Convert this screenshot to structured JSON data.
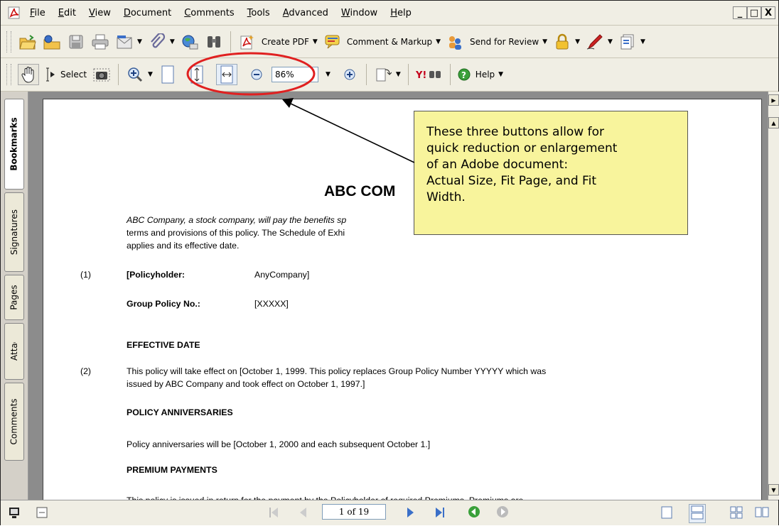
{
  "menu": [
    "File",
    "Edit",
    "View",
    "Document",
    "Comments",
    "Tools",
    "Advanced",
    "Window",
    "Help"
  ],
  "window_controls": [
    "_",
    "□",
    "X"
  ],
  "toolbar1": {
    "create_pdf": "Create PDF",
    "comment_markup": "Comment & Markup",
    "send_for_review": "Send for Review"
  },
  "toolbar2": {
    "select": "Select",
    "zoom_value": "86%",
    "help": "Help"
  },
  "nav_tabs": [
    "Bookmarks",
    "Signatures",
    "Pages",
    "Attachments",
    "Comments"
  ],
  "document": {
    "title": "ABC COM",
    "intro_line1": "ABC Company, a stock company, will pay the benefits sp",
    "intro_line2": "terms and provisions of this policy.  The Schedule of Exhi",
    "intro_line3": "applies and its effective date.",
    "item1_num": "(1)",
    "policyholder_label": "[Policyholder:",
    "policyholder_value": "AnyCompany]",
    "group_policy_label": "Group Policy No.:",
    "group_policy_value": "[XXXXX]",
    "effective_date_heading": "EFFECTIVE DATE",
    "item2_num": "(2)",
    "effective_line1": "This policy will take effect on [October 1, 1999.  This policy replaces Group Policy Number YYYYY which was",
    "effective_line2": "issued by ABC Company and took effect on October 1, 1997.]",
    "anniversaries_heading": "POLICY ANNIVERSARIES",
    "anniversaries_text": "Policy anniversaries will be [October 1, 2000 and each subsequent October 1.]",
    "premium_heading": "PREMIUM PAYMENTS",
    "premium_text": "This policy is issued in return for the payment by the Policyholder of required Premiums.  Premiums are"
  },
  "callout": {
    "line1": "These three buttons allow for",
    "line2": "quick reduction or enlargement",
    "line3": "of an Adobe document:",
    "line4": "Actual Size, Fit Page, and Fit",
    "line5": "Width."
  },
  "status": {
    "page_indicator": "1 of 19"
  },
  "colors": {
    "callout_bg": "#f8f49c",
    "highlight_ellipse": "#e02020",
    "acrobat_red": "#cc1111"
  }
}
